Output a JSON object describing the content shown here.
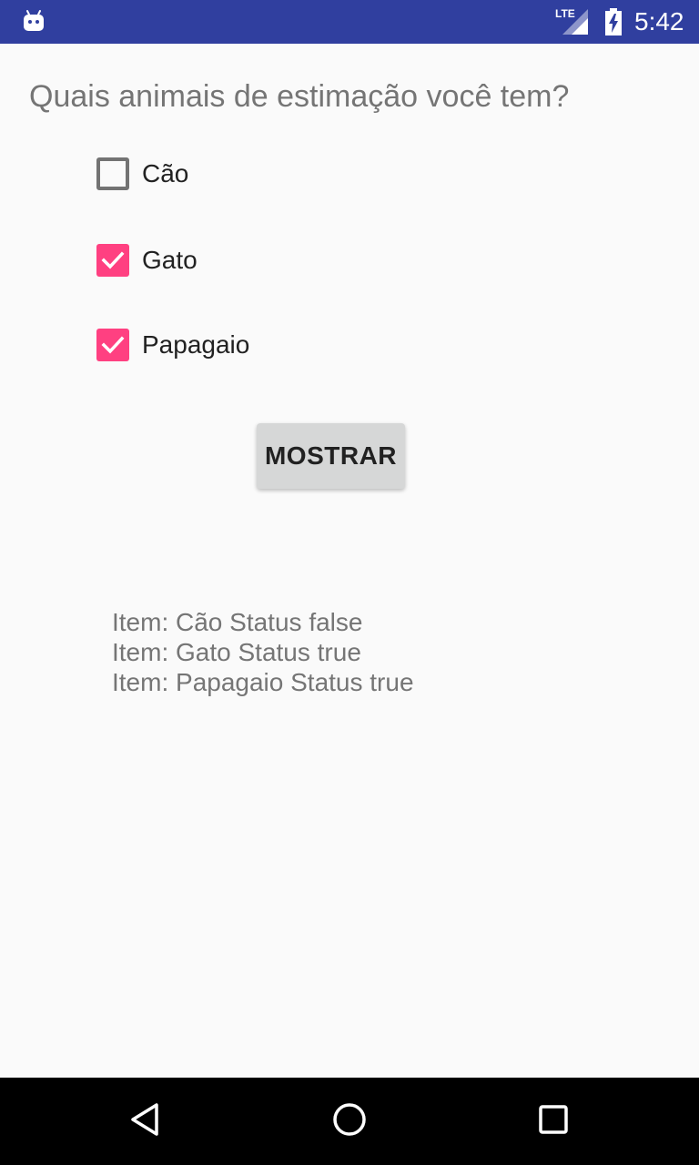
{
  "status_bar": {
    "network_label": "LTE",
    "time": "5:42",
    "icons": [
      "android-debug-icon",
      "lte-signal-icon",
      "battery-charging-icon"
    ],
    "background_color": "#303f9f"
  },
  "main": {
    "question": "Quais animais de estimação você tem?",
    "checkboxes": [
      {
        "label": "Cão",
        "checked": false
      },
      {
        "label": "Gato",
        "checked": true
      },
      {
        "label": "Papagaio",
        "checked": true
      }
    ],
    "button_label": "MOSTRAR",
    "results": [
      "Item: Cão Status false",
      "Item: Gato Status true",
      "Item: Papagaio Status true"
    ],
    "accent_color": "#ff4081"
  },
  "nav_bar": {
    "icons": [
      "back-icon",
      "home-icon",
      "recents-icon"
    ]
  }
}
